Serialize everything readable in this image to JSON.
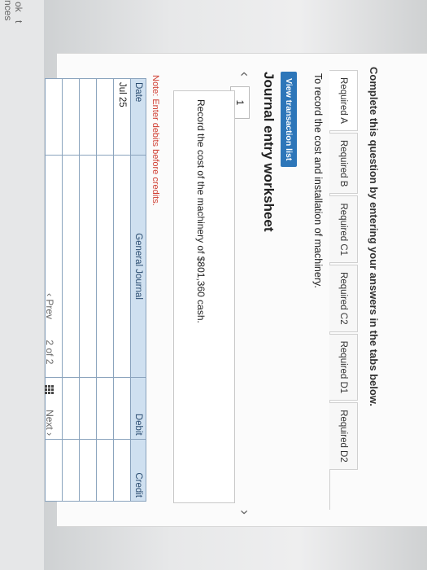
{
  "sidebar": {
    "items": [
      {
        "label": "ok"
      },
      {
        "label": "t"
      },
      {
        "label": "nces"
      }
    ]
  },
  "instructions": "Complete this question by entering your answers in the tabs below.",
  "tabs": [
    {
      "label": "Required A"
    },
    {
      "label": "Required B"
    },
    {
      "label": "Required C1"
    },
    {
      "label": "Required C2"
    },
    {
      "label": "Required D1"
    },
    {
      "label": "Required D2"
    }
  ],
  "task_text": "To record the cost and installation of machinery.",
  "view_button": "View transaction list",
  "worksheet": {
    "title": "Journal entry worksheet",
    "current": "1",
    "description": "Record the cost of the machinery of $801,360 cash."
  },
  "note": "Note: Enter debits before credits.",
  "table": {
    "headers": {
      "date": "Date",
      "journal": "General Journal",
      "debit": "Debit",
      "credit": "Credit"
    },
    "rows": [
      {
        "date": "Jul 25",
        "journal": "",
        "debit": "",
        "credit": ""
      },
      {
        "date": "",
        "journal": "",
        "debit": "",
        "credit": ""
      },
      {
        "date": "",
        "journal": "",
        "debit": "",
        "credit": ""
      },
      {
        "date": "",
        "journal": "",
        "debit": "",
        "credit": ""
      },
      {
        "date": "",
        "journal": "",
        "debit": "",
        "credit": ""
      }
    ]
  },
  "pagination": {
    "prev": "Prev",
    "page_of": "2 of 2",
    "next": "Next"
  },
  "colors": {
    "accent": "#2d76b9",
    "note": "#cf3b2f",
    "table_header": "#cfe0f0"
  }
}
